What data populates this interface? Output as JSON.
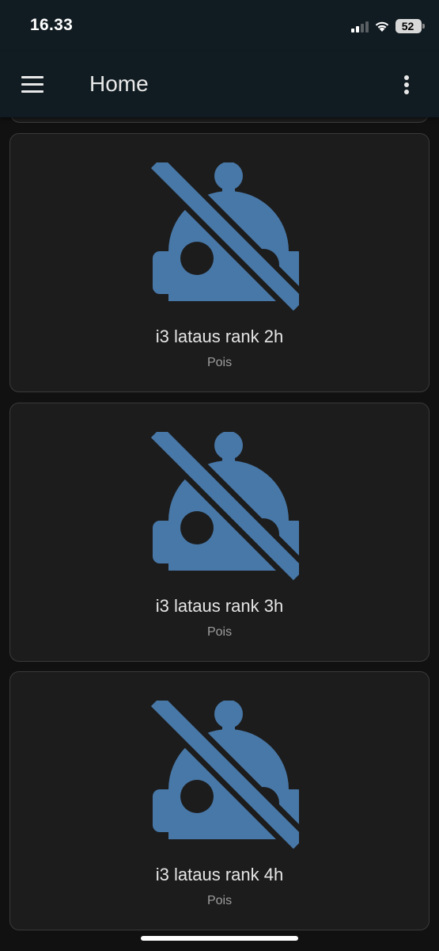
{
  "status_bar": {
    "time": "16.33",
    "battery_level": "52",
    "signal_bars_active": 2,
    "signal_bars_total": 4,
    "icons": [
      "signal-icon",
      "wifi-icon",
      "battery-icon"
    ]
  },
  "app_bar": {
    "title": "Home",
    "menu_icon": "hamburger-menu-icon",
    "overflow_icon": "overflow-menu-icon"
  },
  "colors": {
    "background": "#111111",
    "app_bar": "#111c22",
    "card": "#1c1c1c",
    "card_border": "#3a3a3a",
    "icon_accent": "#4878a8"
  },
  "cards": [
    {
      "name": "i3 lataus rank 2h",
      "state": "Pois",
      "icon": "robot-off-icon"
    },
    {
      "name": "i3 lataus rank 3h",
      "state": "Pois",
      "icon": "robot-off-icon"
    },
    {
      "name": "i3 lataus rank 4h",
      "state": "Pois",
      "icon": "robot-off-icon"
    }
  ]
}
